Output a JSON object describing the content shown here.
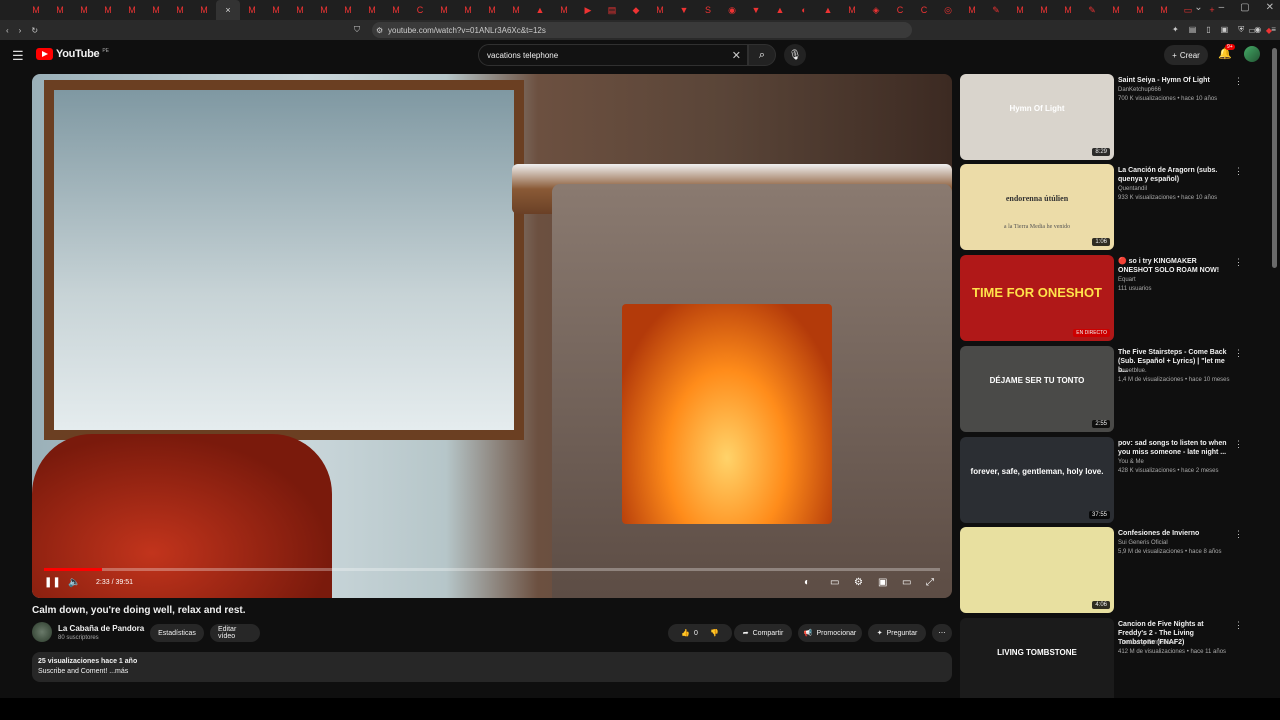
{
  "browser": {
    "active_tab_close": "×",
    "url": "youtube.com/watch?v=01ANLr3A6Xc&t=12s",
    "tab_icons": [
      "M",
      "M",
      "M",
      "M",
      "M",
      "M",
      "M",
      "M",
      "×",
      "M",
      "M",
      "M",
      "M",
      "M",
      "M",
      "M",
      "C",
      "M",
      "M",
      "M",
      "M",
      "▲",
      "M",
      "▶",
      "▤",
      "◆",
      "M",
      "▼",
      "S",
      "◉",
      "▼",
      "▲",
      "◐",
      "▲",
      "M",
      "◈",
      "C",
      "C",
      "◎",
      "M",
      "✎",
      "M",
      "M",
      "M",
      "✎",
      "M",
      "M",
      "M",
      "▭",
      "+"
    ]
  },
  "youtube": {
    "logo_text": "YouTube",
    "logo_suffix": "PE",
    "search_value": "vacations telephone",
    "create_label": "Crear",
    "notifications_badge": "9+"
  },
  "player": {
    "time": "2:33 / 39:51",
    "progress_fraction": 0.065
  },
  "video": {
    "title": "Calm down, you're doing well, relax and rest.",
    "channel_name": "La Cabaña de Pandora",
    "channel_subs": "80 suscriptores",
    "stats_label": "Estadísticas",
    "edit_label": "Editar vídeo",
    "likes": "0",
    "share_label": "Compartir",
    "promote_label": "Promocionar",
    "ask_label": "Preguntar",
    "description_meta": "25 visualizaciones  hace 1 año",
    "description_text": "Suscribe and Coment! ...más"
  },
  "recommendations": [
    {
      "title": "Saint Seiya - Hymn Of Light",
      "channel": "DanKetchup666",
      "meta": "700 K visualizaciones • hace 10 años",
      "duration": "8:29",
      "thumb_bg": "#d9d4cc",
      "thumb_text": "Hymn Of Light"
    },
    {
      "title": "La Canción de Aragorn (subs. quenya y español)",
      "channel": "Quentandil",
      "meta": "933 K visualizaciones • hace 10 años",
      "duration": "1:06",
      "thumb_bg": "#ecdca8",
      "thumb_text": "endorenna útúlien",
      "thumb_sub": "a la Tierra Media he venido"
    },
    {
      "title": "🔴 so i try KINGMAKER ONESHOT SOLO ROAM NOW!",
      "channel": "Equart",
      "meta": "111 usuarios",
      "duration": "EN DIRECTO",
      "live": true,
      "thumb_bg": "#b01818",
      "thumb_text": "TIME FOR ONESHOT"
    },
    {
      "title": "The Five Stairsteps - Come Back (Sub. Español + Lyrics) | \"let me b...",
      "channel": "sweetblue.",
      "meta": "1,4 M de visualizaciones • hace 10 meses",
      "duration": "2:55",
      "thumb_bg": "#4a4a48",
      "thumb_text": "DÉJAME SER TU TONTO"
    },
    {
      "title": "pov: sad songs to listen to when you miss someone - late night ...",
      "channel": "You & Me",
      "meta": "428 K visualizaciones • hace 2 meses",
      "duration": "37:55",
      "thumb_bg": "#2b2e33",
      "thumb_text": "forever, safe, gentleman, holy love."
    },
    {
      "title": "Confesiones de Invierno",
      "channel": "Sui Generis Oficial",
      "meta": "5,9 M de visualizaciones • hace 8 años",
      "duration": "4:06",
      "thumb_bg": "#e8e0a0",
      "thumb_text": ""
    },
    {
      "title": "Cancion de Five Nights at Freddy's 2 - The Living Tombstone (FNAF2)",
      "channel": "The Living Tombstone",
      "meta": "412 M de visualizaciones • hace 11 años",
      "duration": "",
      "thumb_bg": "#1b1b1b",
      "thumb_text": "LIVING TOMBSTONE"
    }
  ]
}
